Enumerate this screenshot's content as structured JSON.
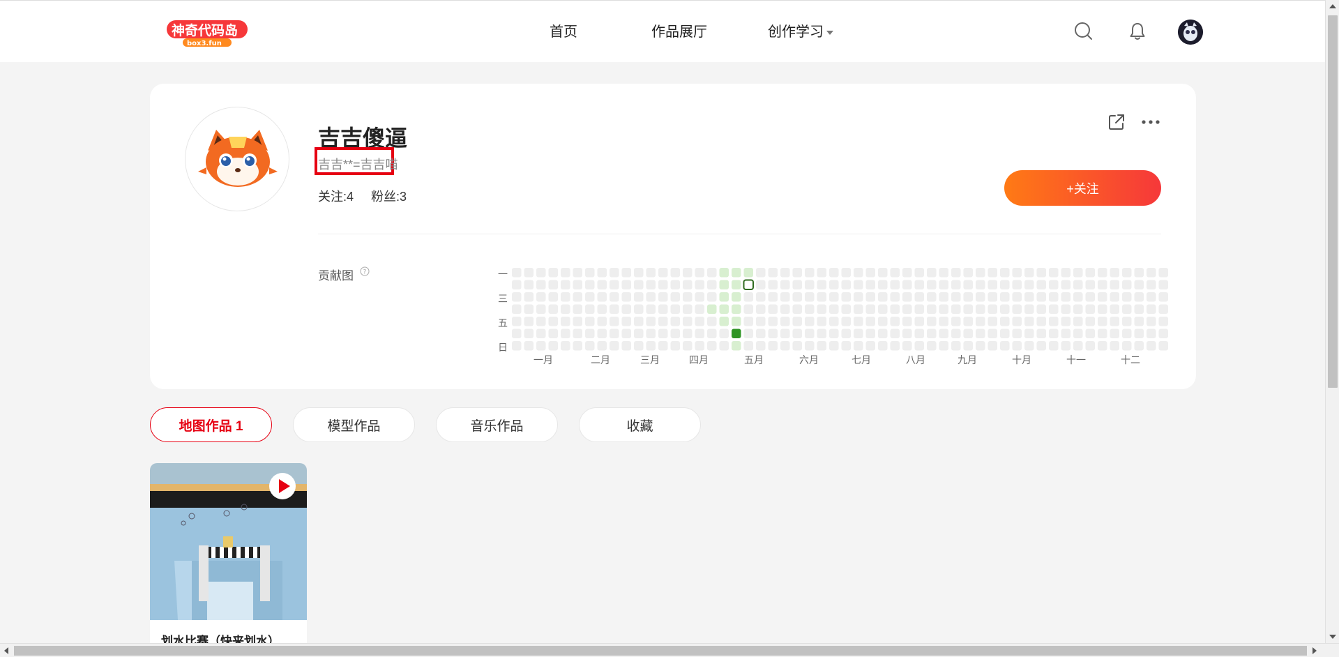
{
  "header": {
    "logo_text": "神奇代码岛",
    "logo_subtext": "box3.fun",
    "nav": [
      "首页",
      "作品展厅",
      "创作学习"
    ]
  },
  "profile": {
    "username": "吉吉傻逼",
    "signature": "吉吉**=吉吉喵",
    "following": "关注:4",
    "followers": "粉丝:3",
    "follow_button": "+关注",
    "contribution_label": "贡献图"
  },
  "contribution": {
    "weekday_labels": [
      "一",
      "三",
      "五",
      "日"
    ],
    "month_labels": [
      "一月",
      "二月",
      "三月",
      "四月",
      "五月",
      "六月",
      "七月",
      "八月",
      "九月",
      "十月",
      "十一",
      "十二"
    ],
    "colors": {
      "empty": "#eeeeee",
      "light": "#d8efd0",
      "dark": "#2f9424",
      "outline": "#2f6b1f"
    },
    "week_count": 54,
    "active_cells": [
      {
        "week": 16,
        "day": 3,
        "level": "light"
      },
      {
        "week": 17,
        "day": 0,
        "level": "light"
      },
      {
        "week": 17,
        "day": 1,
        "level": "light"
      },
      {
        "week": 17,
        "day": 2,
        "level": "light"
      },
      {
        "week": 17,
        "day": 3,
        "level": "light"
      },
      {
        "week": 17,
        "day": 4,
        "level": "light"
      },
      {
        "week": 18,
        "day": 0,
        "level": "light"
      },
      {
        "week": 18,
        "day": 1,
        "level": "light"
      },
      {
        "week": 18,
        "day": 2,
        "level": "light"
      },
      {
        "week": 18,
        "day": 3,
        "level": "light"
      },
      {
        "week": 18,
        "day": 4,
        "level": "light"
      },
      {
        "week": 18,
        "day": 5,
        "level": "dark"
      },
      {
        "week": 18,
        "day": 6,
        "level": "light"
      },
      {
        "week": 19,
        "day": 0,
        "level": "light"
      },
      {
        "week": 19,
        "day": 1,
        "level": "today"
      }
    ]
  },
  "tabs": [
    {
      "label": "地图作品 1",
      "active": true
    },
    {
      "label": "模型作品",
      "active": false
    },
    {
      "label": "音乐作品",
      "active": false
    },
    {
      "label": "收藏",
      "active": false
    }
  ],
  "works": [
    {
      "title": "划水比赛（快来划水）"
    }
  ]
}
